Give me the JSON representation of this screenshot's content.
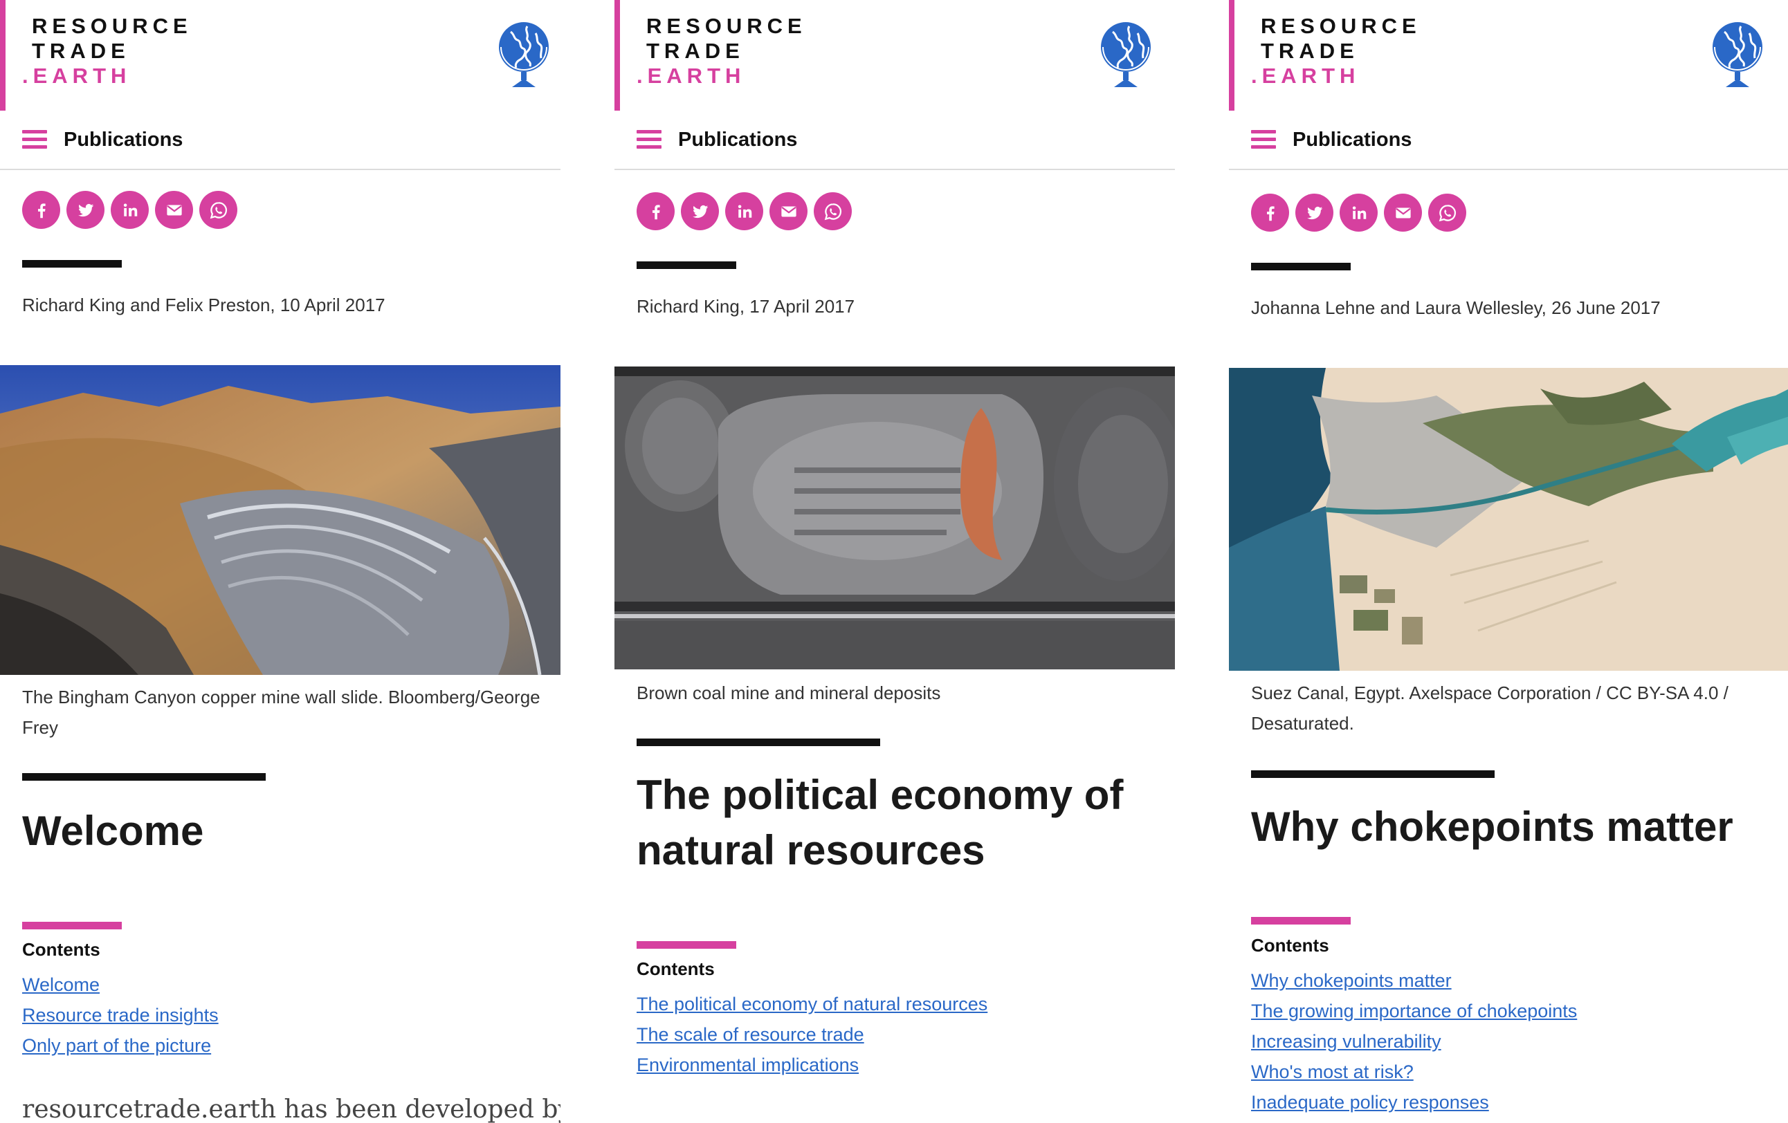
{
  "brand": {
    "line1": "RESOURCE",
    "line2": "TRADE",
    "line3": ".EARTH",
    "accent": "#d6409f",
    "logo_icon": "globe-icon"
  },
  "nav": {
    "menu_label": "Publications",
    "menu_icon": "hamburger-icon"
  },
  "share_icons": [
    "facebook-icon",
    "twitter-icon",
    "linkedin-icon",
    "email-icon",
    "whatsapp-icon"
  ],
  "panels": [
    {
      "byline": "Richard King and Felix Preston, 10 April 2017",
      "caption": "The Bingham Canyon copper mine wall slide. Bloomberg/George Frey",
      "title": "Welcome",
      "contents_heading": "Contents",
      "toc": [
        "Welcome",
        "Resource trade insights",
        "Only part of the picture"
      ],
      "body_start": "resourcetrade.earth has been developed by"
    },
    {
      "byline": "Richard King, 17 April 2017",
      "caption": "Brown coal mine and mineral deposits",
      "title": "The political economy of natural resources",
      "contents_heading": "Contents",
      "toc": [
        "The political economy of natural resources",
        "The scale of resource trade",
        "Environmental implications"
      ]
    },
    {
      "byline": "Johanna Lehne and Laura Wellesley, 26 June 2017",
      "caption": "Suez Canal, Egypt. Axelspace Corporation / CC BY-SA 4.0 / Desaturated.",
      "title": "Why chokepoints matter",
      "contents_heading": "Contents",
      "toc": [
        "Why chokepoints matter",
        "The growing importance of chokepoints",
        "Increasing vulnerability",
        "Who's most at risk?",
        "Inadequate policy responses"
      ]
    }
  ]
}
